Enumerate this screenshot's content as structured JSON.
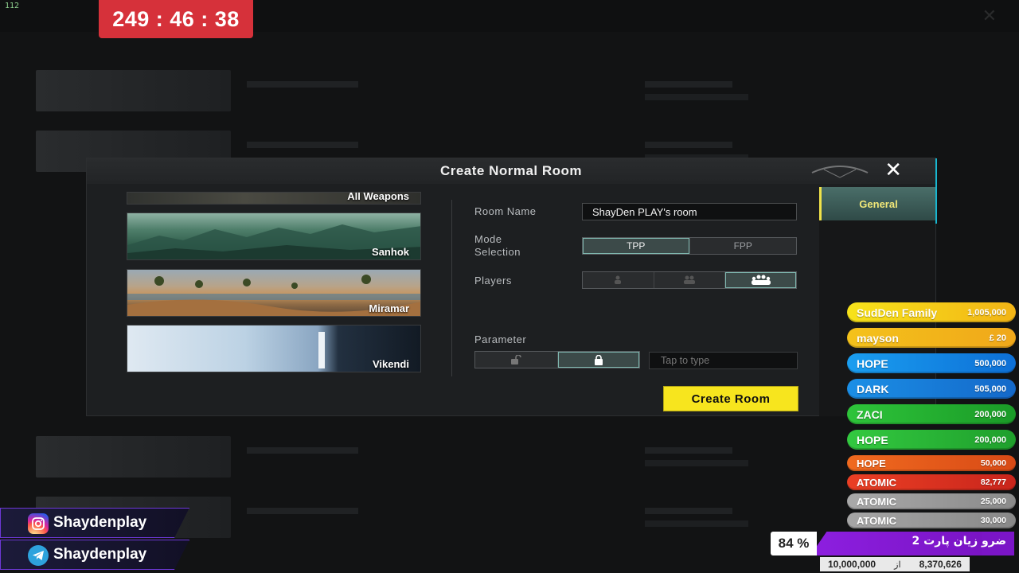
{
  "overlay": {
    "fps": "112",
    "timer": "249 : 46 : 38"
  },
  "dialog": {
    "title": "Create Normal Room",
    "maps": [
      {
        "name": "All Weapons"
      },
      {
        "name": "Sanhok"
      },
      {
        "name": "Miramar"
      },
      {
        "name": "Vikendi"
      }
    ],
    "room_name_label": "Room Name",
    "room_name_value": "ShayDen PLAY's room",
    "mode_label": "Mode\nSelection",
    "mode_options": [
      "TPP",
      "FPP"
    ],
    "mode_selected": "TPP",
    "players_label": "Players",
    "parameter_label": "Parameter",
    "password_placeholder": "Tap to type",
    "create_button": "Create Room",
    "side_tab": "General"
  },
  "leaderboard": [
    {
      "name": "SudDen Family",
      "amount": "1,005,000",
      "color_from": "#f7e31a",
      "color_to": "#f2b416"
    },
    {
      "name": "mayson",
      "amount": "£ 20",
      "color_from": "#f4c21b",
      "color_to": "#f0a71a"
    },
    {
      "name": "HOPE",
      "amount": "500,000",
      "color_from": "#1a9ef0",
      "color_to": "#0d6fd6"
    },
    {
      "name": "DARK",
      "amount": "505,000",
      "color_from": "#1b8fe6",
      "color_to": "#1468c9"
    },
    {
      "name": "ZACI",
      "amount": "200,000",
      "color_from": "#2ec43a",
      "color_to": "#1a9a27"
    },
    {
      "name": "HOPE",
      "amount": "200,000",
      "color_from": "#33c940",
      "color_to": "#1f9f2c"
    },
    {
      "name": "HOPE",
      "amount": "50,000",
      "color_from": "#f06a1f",
      "color_to": "#d84a16"
    },
    {
      "name": "ATOMIC",
      "amount": "82,777",
      "color_from": "#ea3f24",
      "color_to": "#c9251c"
    },
    {
      "name": "ATOMIC",
      "amount": "25,000",
      "color_from": "#a9a9a9",
      "color_to": "#8a8a8a"
    },
    {
      "name": "ATOMIC",
      "amount": "30,000",
      "color_from": "#a6a6a6",
      "color_to": "#888888"
    }
  ],
  "goal": {
    "percent": 84,
    "percent_label": "84 %",
    "title": "ضرو زیان پارت 2",
    "target": "10,000,000",
    "of_label": "از",
    "current": "8,370,626"
  },
  "social": {
    "instagram": "Shaydenplay",
    "telegram": "Shaydenplay"
  }
}
